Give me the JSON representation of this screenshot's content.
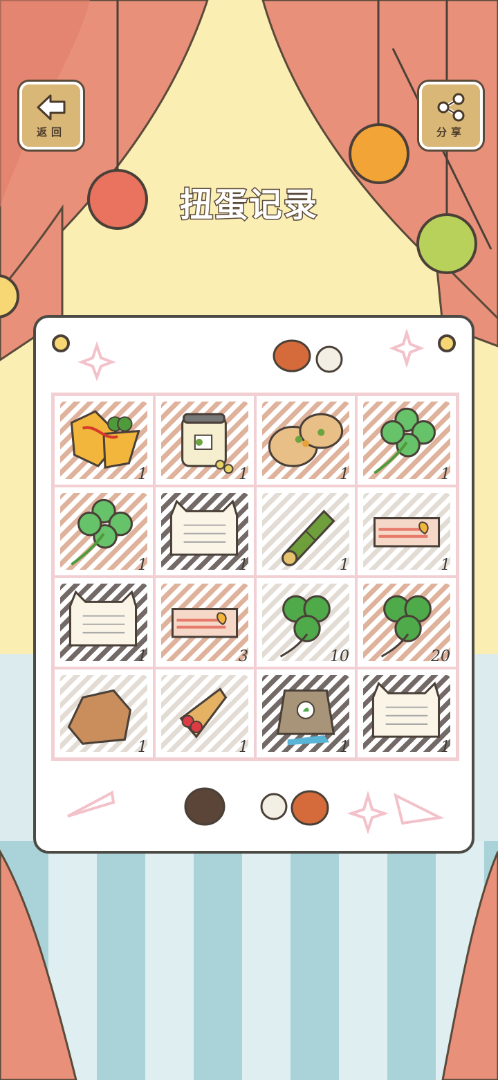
{
  "header": {
    "back_label": "返回",
    "share_label": "分享",
    "title": "扭蛋记录"
  },
  "icons": {
    "back": "left-arrow-icon",
    "share": "share-icon"
  },
  "colors": {
    "curtain": "#e9907a",
    "wall": "#fbeeb2",
    "board_border": "#4c4a44",
    "grid_line": "#f2cfd3",
    "button_wood": "#d9b777"
  },
  "grid": {
    "items": [
      {
        "name": "omelette",
        "count": "1"
      },
      {
        "name": "chickpea-jar",
        "count": "1"
      },
      {
        "name": "pita-sandwich",
        "count": "1"
      },
      {
        "name": "four-leaf-clover",
        "count": "1"
      },
      {
        "name": "four-leaf-clover",
        "count": "1"
      },
      {
        "name": "cat-letter",
        "count": "1"
      },
      {
        "name": "bamboo-tube",
        "count": "1"
      },
      {
        "name": "sunrise-ticket",
        "count": "1"
      },
      {
        "name": "cat-letter",
        "count": "1"
      },
      {
        "name": "sunrise-ticket",
        "count": "3"
      },
      {
        "name": "three-leaf-clover",
        "count": "10"
      },
      {
        "name": "three-leaf-clover",
        "count": "20"
      },
      {
        "name": "rock",
        "count": "1"
      },
      {
        "name": "strawberry-crepe",
        "count": "1"
      },
      {
        "name": "seed-bag",
        "count": "1"
      },
      {
        "name": "cat-letter",
        "count": "1"
      }
    ]
  }
}
